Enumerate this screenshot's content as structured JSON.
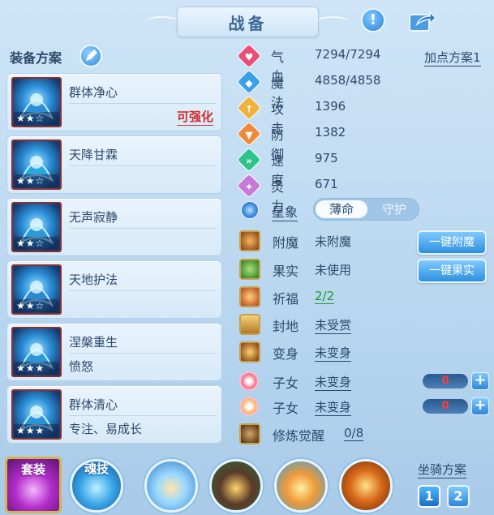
{
  "header": {
    "title": "战备"
  },
  "equip_plan": {
    "label": "装备方案",
    "cards": [
      {
        "name": "群体净心",
        "sub": "",
        "tag": "可强化",
        "stars": "★★☆",
        "color": "#2c8fd8"
      },
      {
        "name": "天降甘霖",
        "sub": "",
        "tag": "",
        "stars": "★★☆",
        "color": "#2aa6e0"
      },
      {
        "name": "无声寂静",
        "sub": "",
        "tag": "",
        "stars": "★★☆",
        "color": "#2a9ad8"
      },
      {
        "name": "天地护法",
        "sub": "",
        "tag": "",
        "stars": "★★☆",
        "color": "#2c86d0"
      },
      {
        "name": "涅槃重生",
        "sub": "愤怒",
        "tag": "",
        "stars": "★★★",
        "color": "#2a98d8"
      },
      {
        "name": "群体清心",
        "sub": "专注、易成长",
        "tag": "",
        "stars": "★★★",
        "color": "#2a94d8"
      }
    ]
  },
  "stats": {
    "addpoint_label": "加点方案1",
    "items": [
      {
        "label": "气血",
        "value": "7294/7294",
        "color": "#e8507a",
        "glyph": "♥"
      },
      {
        "label": "魔法",
        "value": "4858/4858",
        "color": "#3aa0e8",
        "glyph": "◆"
      },
      {
        "label": "攻击",
        "value": "1396",
        "color": "#f0b23a",
        "glyph": "↑"
      },
      {
        "label": "防御",
        "value": "1382",
        "color": "#f08a3a",
        "glyph": "▼"
      },
      {
        "label": "速度",
        "value": "975",
        "color": "#2fc28a",
        "glyph": "»"
      },
      {
        "label": "灵力",
        "value": "671",
        "color": "#c67ad8",
        "glyph": "✦"
      }
    ]
  },
  "star_sign": {
    "label": "星象",
    "options": [
      "薄命",
      "守护"
    ],
    "selected": "薄命"
  },
  "features": {
    "enchant": {
      "label": "附魔",
      "value": "未附魔",
      "button": "一键附魔"
    },
    "fruit": {
      "label": "果实",
      "value": "未使用",
      "button": "一键果实"
    },
    "blessing": {
      "label": "祈福",
      "value": "2/2"
    },
    "fengdi": {
      "label": "封地",
      "value": "未受赏"
    },
    "transform": {
      "label": "变身",
      "value": "未变身"
    },
    "child1": {
      "label": "子女",
      "value": "未变身",
      "count": "0"
    },
    "child2": {
      "label": "子女",
      "value": "未变身",
      "count": "0"
    },
    "cultivation": {
      "label": "修炼觉醒",
      "value": "0/8"
    }
  },
  "bottom": {
    "suit_label": "套装",
    "soul_label": "魂技",
    "mount_label": "坐骑方案",
    "mount_buttons": [
      "1",
      "2"
    ]
  }
}
